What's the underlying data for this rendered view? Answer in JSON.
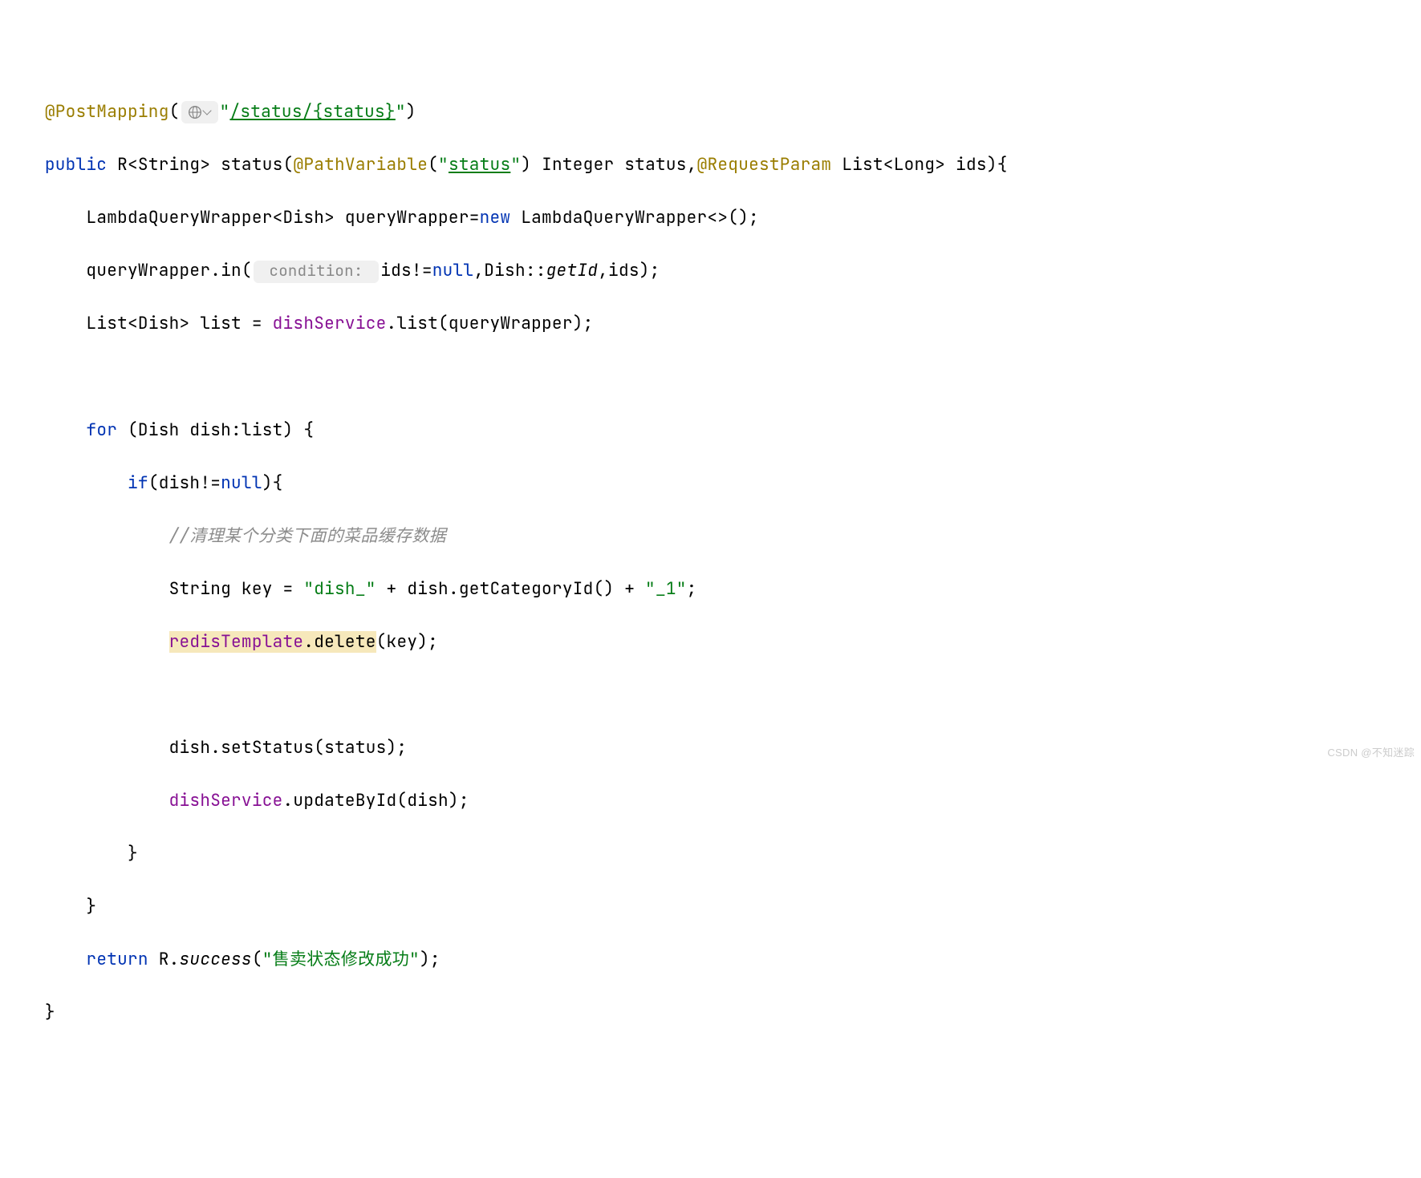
{
  "code": {
    "line1": {
      "annotation": "@PostMapping",
      "paren_open": "(",
      "string_open": "\"",
      "url_path": "/status/{status}",
      "string_close": "\"",
      "paren_close": ")"
    },
    "line2": {
      "modifier": "public",
      "return_type": "R<String> ",
      "method_name": "status",
      "paren_open": "(",
      "anno1": "@PathVariable",
      "anno1_paren": "(",
      "anno1_str_open": "\"",
      "anno1_value": "status",
      "anno1_str_close": "\"",
      "anno1_paren_close": ") ",
      "param1_type": "Integer ",
      "param1_name": "status",
      "comma": ",",
      "anno2": "@RequestParam",
      "param2_type": " List<Long> ",
      "param2_name": "ids",
      "paren_close": ")",
      "brace": "{"
    },
    "line3": {
      "indent": "    ",
      "text1": "LambdaQueryWrapper<Dish> queryWrapper=",
      "keyword_new": "new",
      "text2": " LambdaQueryWrapper<>();"
    },
    "line4": {
      "indent": "    ",
      "text1": "queryWrapper.in(",
      "hint": " condition: ",
      "text2": "ids!=",
      "null_kw": "null",
      "text3": ",Dish::",
      "method_ref": "getId",
      "text4": ",ids);"
    },
    "line5": {
      "indent": "    ",
      "text1": "List<Dish> list = ",
      "field": "dishService",
      "text2": ".list(queryWrapper);"
    },
    "line6": {
      "content": ""
    },
    "line7": {
      "indent": "    ",
      "for_kw": "for",
      "text1": " (Dish dish:list) {"
    },
    "line8": {
      "indent": "        ",
      "if_kw": "if",
      "text1": "(dish!=",
      "null_kw": "null",
      "text2": "){"
    },
    "line9": {
      "indent": "            ",
      "comment": "//清理某个分类下面的菜品缓存数据"
    },
    "line10": {
      "indent": "            ",
      "text1": "String key = ",
      "str1": "\"dish_\"",
      "text2": " + dish.getCategoryId() + ",
      "str2": "\"_1\"",
      "text3": ";"
    },
    "line11": {
      "indent": "            ",
      "hl_field": "redisTemplate",
      "hl_dot": ".",
      "hl_method": "delete",
      "text1": "(key);"
    },
    "line12": {
      "content": ""
    },
    "line13": {
      "indent": "            ",
      "text1": "dish.setStatus(status);"
    },
    "line14": {
      "indent": "            ",
      "field": "dishService",
      "text1": ".updateById(dish);"
    },
    "line15": {
      "indent": "        ",
      "brace": "}"
    },
    "line16": {
      "indent": "    ",
      "brace": "}"
    },
    "line17": {
      "indent": "    ",
      "return_kw": "return",
      "text1": " R.",
      "static_method": "success",
      "paren_open": "(",
      "str": "\"售卖状态修改成功\"",
      "paren_close": ");"
    },
    "line18": {
      "brace": "}"
    }
  },
  "watermark": "CSDN @不知迷踪"
}
